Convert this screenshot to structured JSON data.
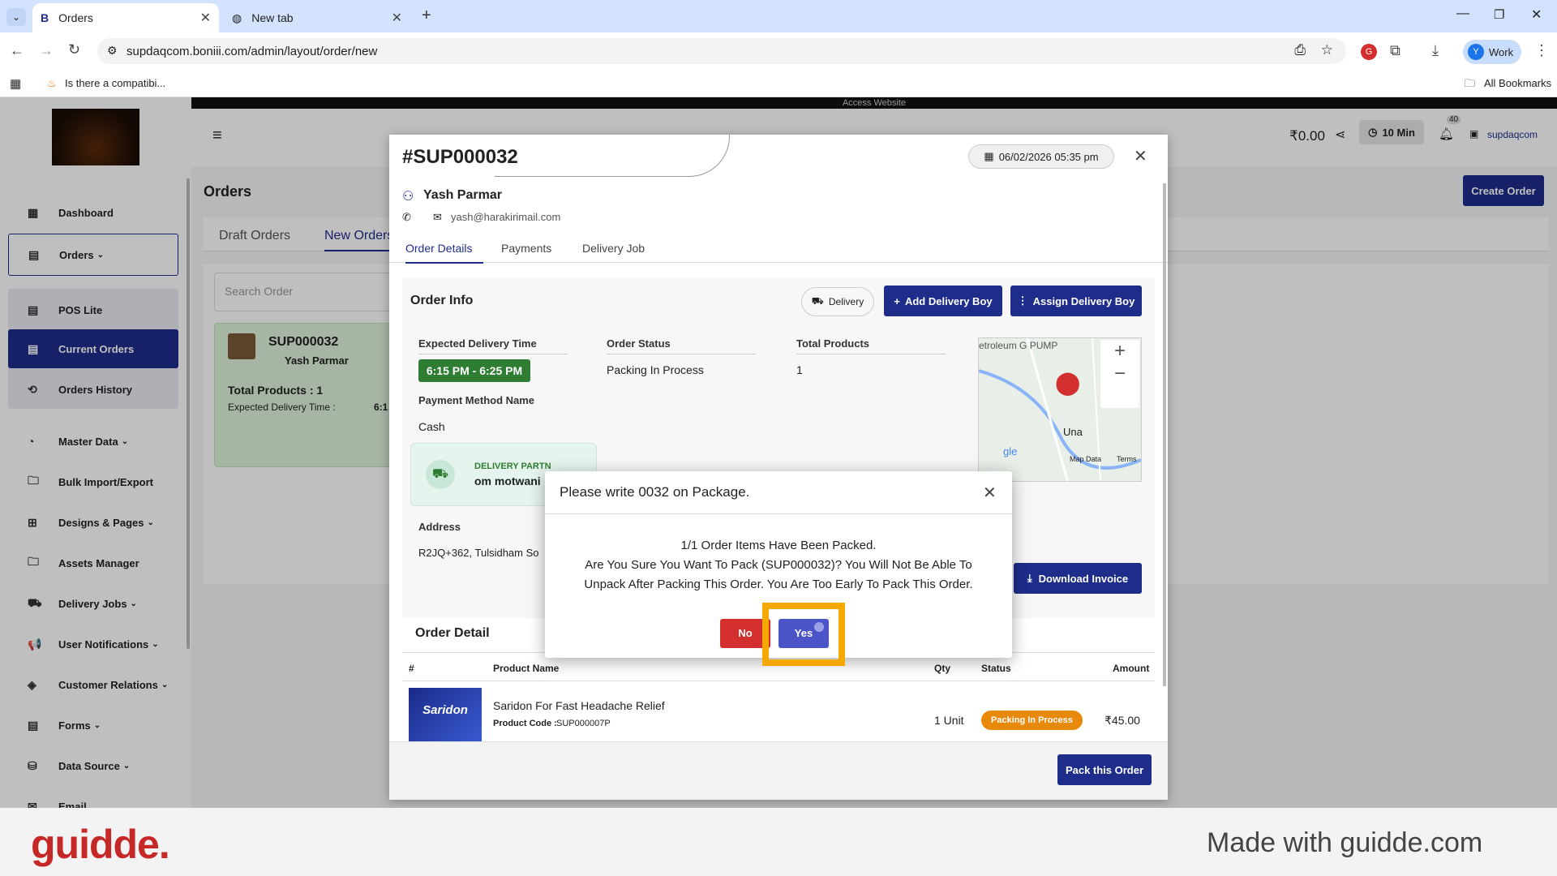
{
  "browser": {
    "tabs": [
      {
        "label": "Orders"
      },
      {
        "label": "New tab"
      }
    ],
    "url": "supdaqcom.boniii.com/admin/layout/order/new",
    "profile": "Work",
    "bookmark": "Is there a compatibi...",
    "all_bookmarks": "All Bookmarks"
  },
  "app": {
    "access_banner": "Access Website",
    "balance": "₹0.00",
    "timer": "10 Min",
    "notif_count": "40",
    "store": "supdaqcom",
    "page_title": "Orders",
    "create_order": "Create Order",
    "tabs": [
      "Draft Orders",
      "New Orders"
    ],
    "search_placeholder": "Search Order",
    "card": {
      "id": "SUP000032",
      "customer": "Yash Parmar",
      "total": "Total Products : 1",
      "expected": "Expected Delivery Time :",
      "time_short": "6:1"
    }
  },
  "sidebar": {
    "items": [
      {
        "label": "Dashboard",
        "icon": "dashboard-icon"
      },
      {
        "label": "Orders",
        "icon": "orders-icon"
      },
      {
        "label": "POS Lite",
        "icon": "pos-icon"
      },
      {
        "label": "Current Orders",
        "icon": "current-orders-icon"
      },
      {
        "label": "Orders History",
        "icon": "history-icon"
      },
      {
        "label": "Master Data",
        "icon": "master-data-icon"
      },
      {
        "label": "Bulk Import/Export",
        "icon": "folder-icon"
      },
      {
        "label": "Designs & Pages",
        "icon": "designs-icon"
      },
      {
        "label": "Assets Manager",
        "icon": "folder-icon"
      },
      {
        "label": "Delivery Jobs",
        "icon": "delivery-icon"
      },
      {
        "label": "User Notifications",
        "icon": "megaphone-icon"
      },
      {
        "label": "Customer Relations",
        "icon": "handshake-icon"
      },
      {
        "label": "Forms",
        "icon": "forms-icon"
      },
      {
        "label": "Data Source",
        "icon": "database-icon"
      },
      {
        "label": "Email",
        "icon": "email-icon"
      }
    ]
  },
  "order": {
    "id": "#SUP000032",
    "datetime": "06/02/2026 05:35 pm",
    "customer": "Yash Parmar",
    "email": "yash@harakirimail.com",
    "tabs": [
      "Order Details",
      "Payments",
      "Delivery Job"
    ],
    "info_title": "Order Info",
    "delivery_chip": "Delivery",
    "add_delivery_boy": "Add Delivery Boy",
    "assign_delivery_boy": "Assign Delivery Boy",
    "expected_label": "Expected Delivery Time",
    "expected_value": "6:15 PM - 6:25 PM",
    "status_label": "Order Status",
    "status_value": "Packing In Process",
    "total_label": "Total Products",
    "total_value": "1",
    "payment_label": "Payment Method Name",
    "payment_value": "Cash",
    "delivery_partner_label": "DELIVERY PARTN",
    "delivery_partner": "om motwani",
    "address_label": "Address",
    "address_value": "R2JQ+362, Tulsidham So",
    "download_invoice": "Download Invoice",
    "map": {
      "label_top": "etroleum\nG PUMP",
      "city": "Una",
      "map_data": "Map Data",
      "terms": "Terms",
      "google": "gle"
    },
    "detail_title": "Order Detail",
    "table_headers": [
      "#",
      "Product Name",
      "Qty",
      "Status",
      "Amount"
    ],
    "rows": [
      {
        "product": "Saridon For Fast Headache Relief",
        "code_label": "Product Code :",
        "code": "SUP000007P",
        "qty": "1 Unit",
        "status": "Packing In Process",
        "amount": "₹45.00"
      }
    ],
    "pack_button": "Pack this Order"
  },
  "confirm": {
    "title": "Please write 0032 on Package.",
    "line1": "1/1 Order Items Have Been Packed.",
    "line2": "Are You Sure You Want To Pack (SUP000032)? You Will Not Be Able To",
    "line3": "Unpack After Packing This Order. You Are Too Early To Pack This Order.",
    "no": "No",
    "yes": "Yes"
  },
  "footer": {
    "logo": "guidde.",
    "tagline": "Made with guidde.com"
  },
  "colors": {
    "primary": "#1e2d8a",
    "green": "#2e7d32",
    "orange": "#e8890c",
    "red": "#d32f2f",
    "yes": "#4b55c8",
    "highlight": "#f5a800"
  }
}
